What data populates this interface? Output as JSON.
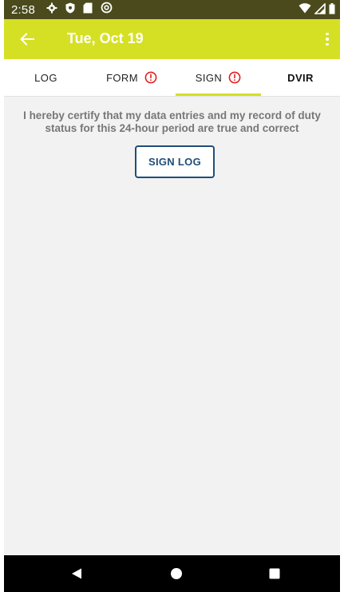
{
  "status_bar": {
    "time": "2:58",
    "icons_left": [
      "gear-icon",
      "shield-icon",
      "sd-card-icon",
      "at-sign-icon"
    ],
    "icons_right": [
      "wifi-icon",
      "signal-icon",
      "battery-icon"
    ]
  },
  "app_bar": {
    "title": "Tue, Oct 19",
    "background": "#d5e024",
    "icons": [
      "back-arrow-icon",
      "more-vert-icon"
    ]
  },
  "tabs": [
    {
      "label": "LOG",
      "alert": false,
      "selected": false
    },
    {
      "label": "FORM",
      "alert": true,
      "selected": false
    },
    {
      "label": "SIGN",
      "alert": true,
      "selected": true
    },
    {
      "label": "DVIR",
      "alert": false,
      "selected": false,
      "bold": true
    }
  ],
  "sign_page": {
    "certification_text": "I hereby certify that my data entries and my record of duty status for this 24-hour period are true and correct",
    "button_label": "SIGN LOG"
  },
  "colors": {
    "accent": "#d5e024",
    "alert": "#e02020",
    "button_text": "#1f4d7a",
    "status_bar": "#4a4a1d",
    "content_bg": "#f2f2f2"
  },
  "nav_bar": {
    "icons": [
      "nav-back-icon",
      "nav-home-icon",
      "nav-recents-icon"
    ]
  }
}
